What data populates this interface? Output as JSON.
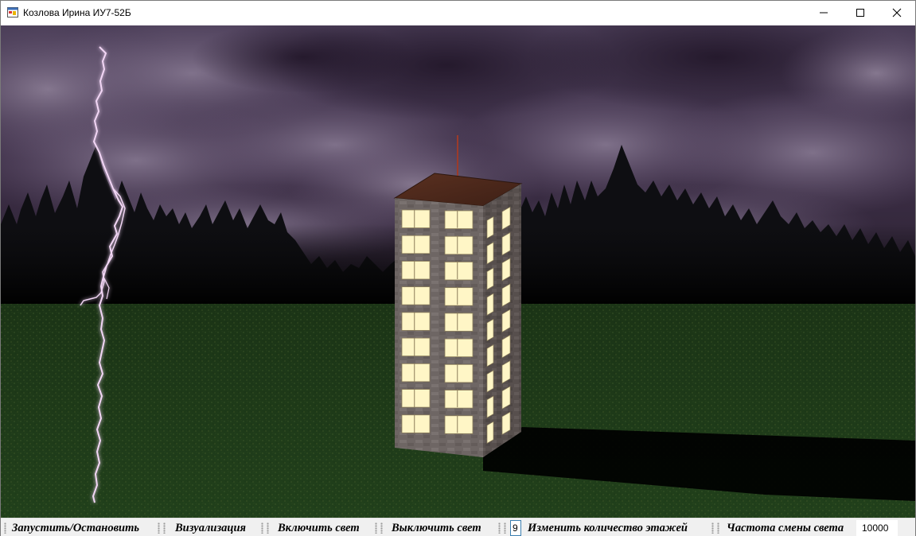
{
  "window": {
    "title": "Козлова Ирина ИУ7-52Б"
  },
  "toolbar": {
    "start_stop_label": "Запустить/Остановить",
    "visualization_label": "Визуализация",
    "light_on_label": "Включить свет",
    "light_off_label": "Выключить свет",
    "floors_value": "9",
    "change_floors_label": "Изменить количество этажей",
    "light_freq_label": "Частота смены света",
    "light_freq_value": "10000"
  },
  "scene": {
    "sky_color": "#3b2d45",
    "grass_color": "#1f3a1a",
    "lightning_color": "#f2d6f5",
    "building_front_color": "#6d6563",
    "building_side_color": "#5d5452",
    "roof_color": "#4e2a1c",
    "window_color": "#fff6c6",
    "antenna_color": "#9b3b2b"
  }
}
